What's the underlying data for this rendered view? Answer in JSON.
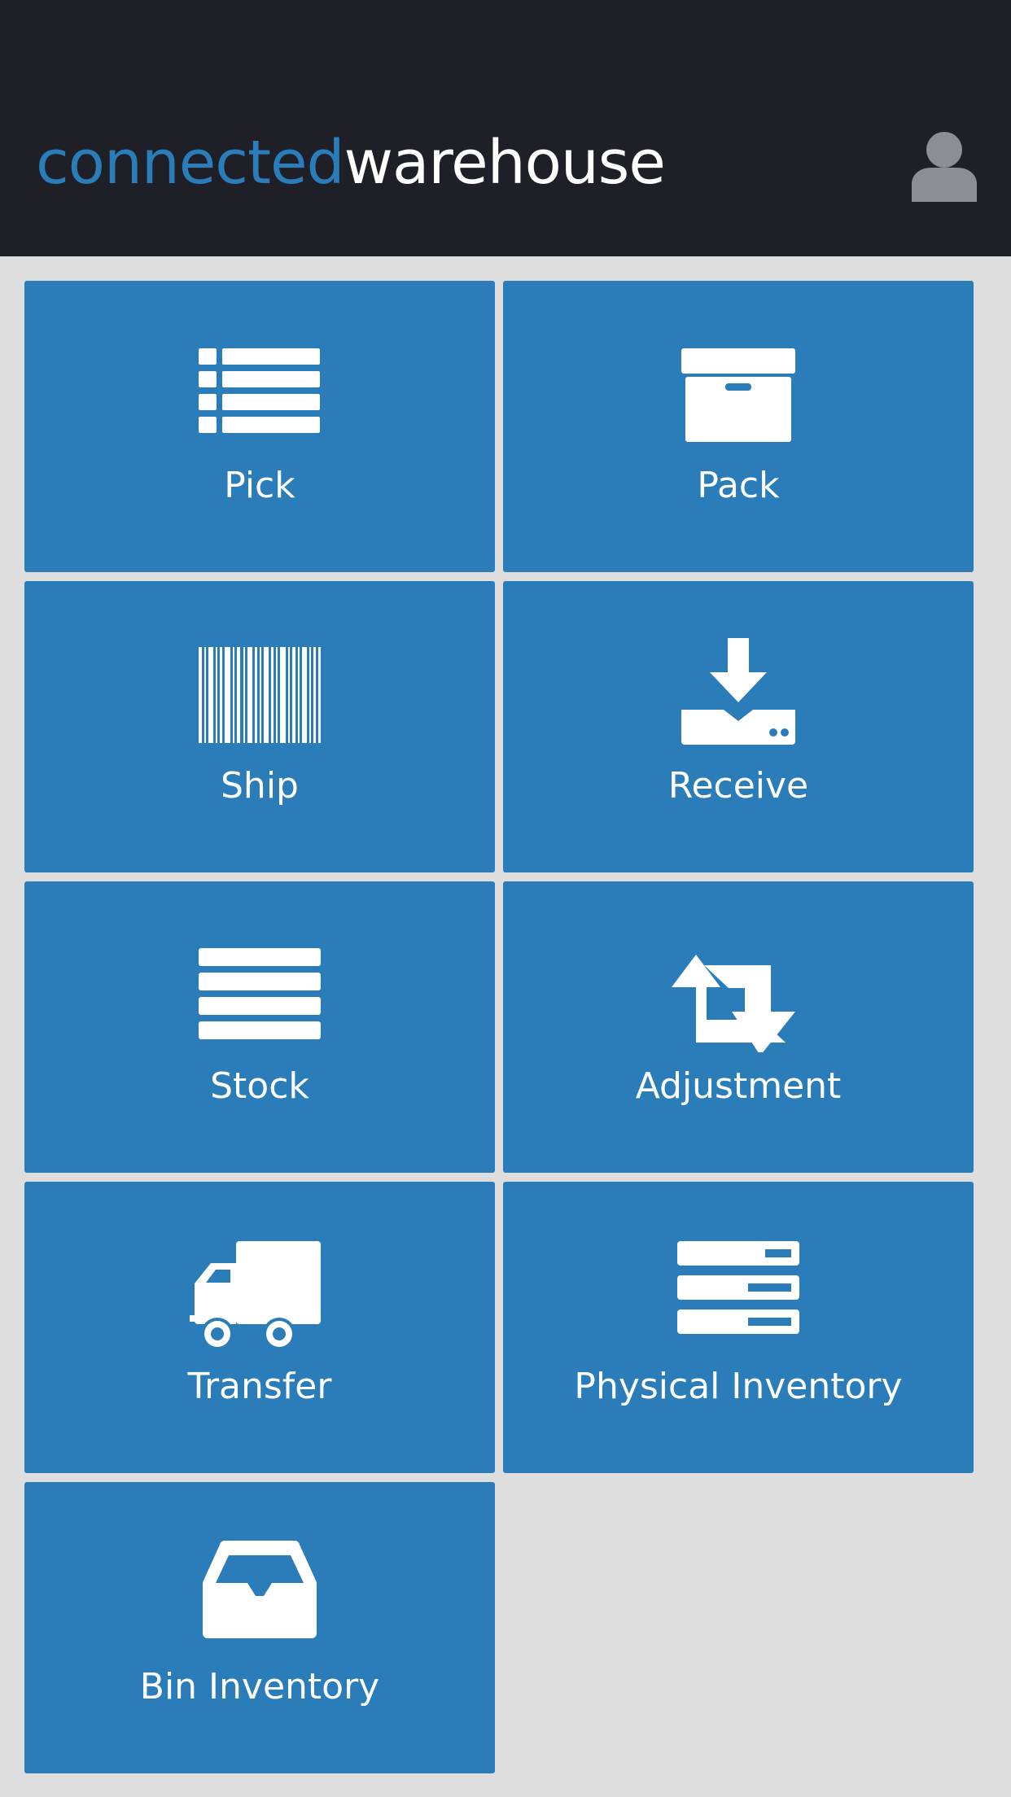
{
  "header": {
    "logo_part1": "connected",
    "logo_part2": "warehouse",
    "user_icon": "user-icon"
  },
  "colors": {
    "header_bg": "#1e1f27",
    "accent": "#2a7db8",
    "page_bg": "#dedede",
    "tile_text": "#ffffff"
  },
  "tiles": [
    {
      "label": "Pick",
      "icon": "list-icon"
    },
    {
      "label": "Pack",
      "icon": "archive-box-icon"
    },
    {
      "label": "Ship",
      "icon": "barcode-icon"
    },
    {
      "label": "Receive",
      "icon": "download-tray-icon"
    },
    {
      "label": "Stock",
      "icon": "bars-icon"
    },
    {
      "label": "Adjustment",
      "icon": "retweet-icon"
    },
    {
      "label": "Transfer",
      "icon": "truck-icon"
    },
    {
      "label": "Physical Inventory",
      "icon": "server-icon"
    },
    {
      "label": "Bin Inventory",
      "icon": "inbox-icon"
    }
  ]
}
